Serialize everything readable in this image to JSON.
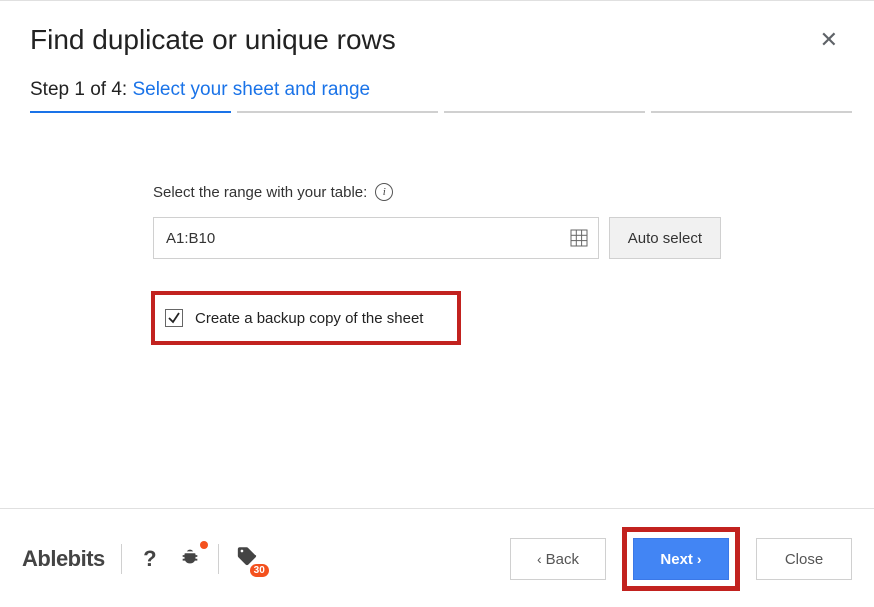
{
  "colors": {
    "accent": "#4285f4",
    "highlight_border": "#c2221f"
  },
  "header": {
    "title": "Find duplicate or unique rows"
  },
  "step": {
    "prefix": "Step 1 of 4:",
    "link_text": "Select your sheet and range",
    "current": 1,
    "total": 4
  },
  "form": {
    "range_label": "Select the range with your table:",
    "range_value": "A1:B10",
    "auto_select_label": "Auto select",
    "backup_checked": true,
    "backup_label": "Create a backup copy of the sheet"
  },
  "footer": {
    "brand": "Ablebits",
    "help_icon": "?",
    "trial_badge": "30",
    "back_label": "Back",
    "next_label": "Next",
    "close_label": "Close"
  }
}
